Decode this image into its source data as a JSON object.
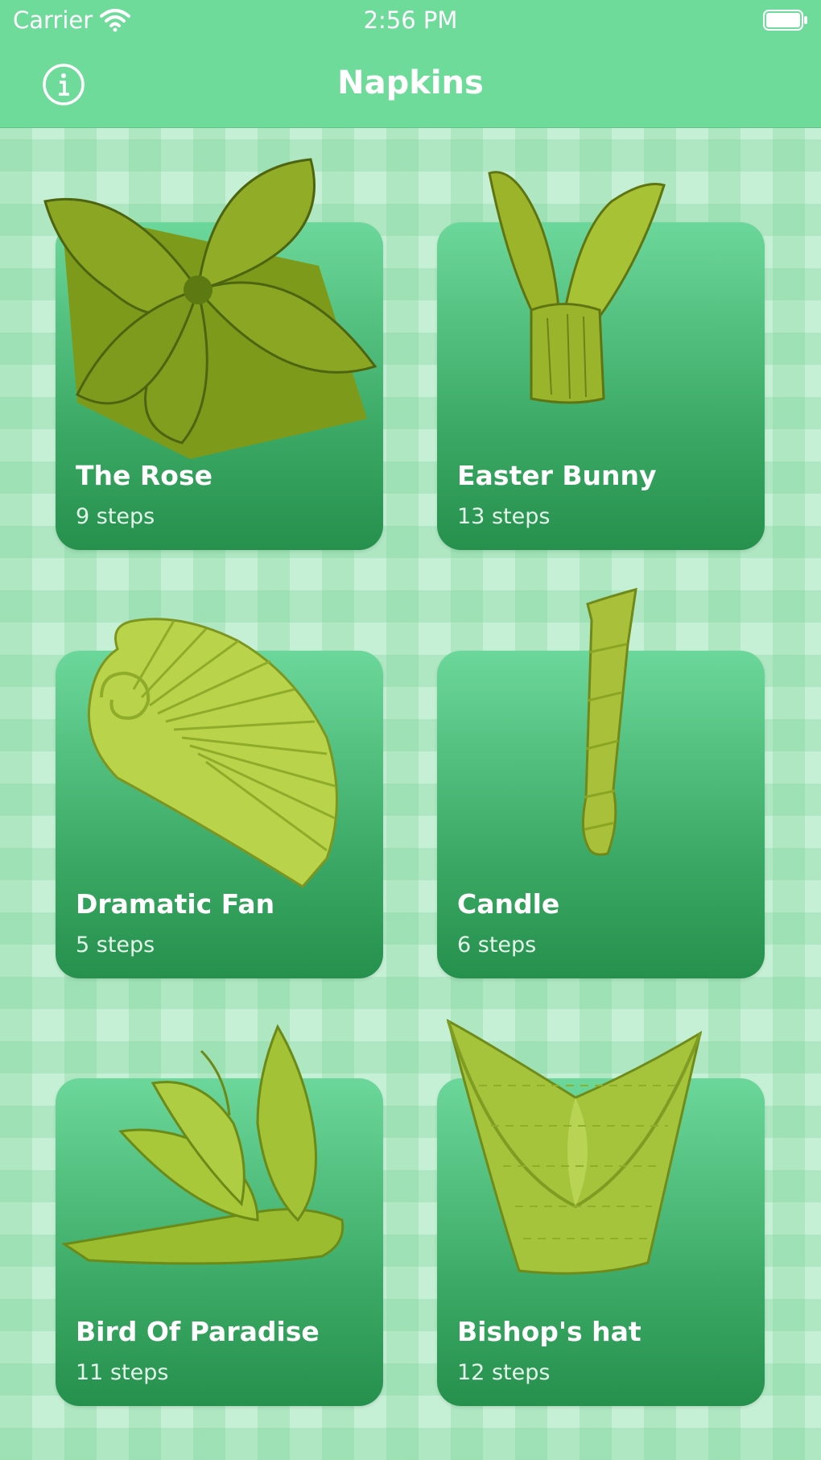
{
  "status_bar": {
    "carrier": "Carrier",
    "time": "2:56 PM"
  },
  "nav": {
    "title": "Napkins"
  },
  "colors": {
    "nav_bar": "#6fdb9a",
    "card_top": "#6cd79a",
    "card_bottom": "#26904d",
    "napkin": "#8fbe2a"
  },
  "napkins": [
    {
      "title": "The Rose",
      "steps": "9 steps"
    },
    {
      "title": "Easter Bunny",
      "steps": "13 steps"
    },
    {
      "title": "Dramatic Fan",
      "steps": "5 steps"
    },
    {
      "title": "Candle",
      "steps": "6 steps"
    },
    {
      "title": "Bird Of Paradise",
      "steps": "11 steps"
    },
    {
      "title": "Bishop's hat",
      "steps": "12 steps"
    }
  ]
}
